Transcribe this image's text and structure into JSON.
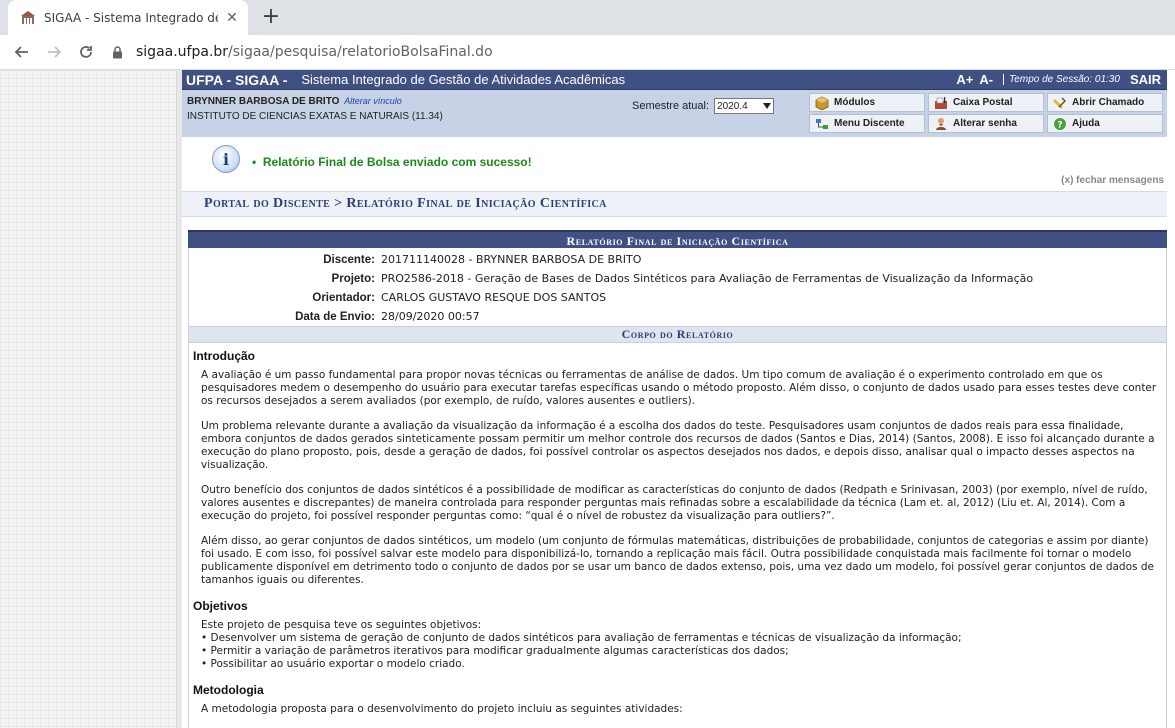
{
  "browser": {
    "tab_title": "SIGAA - Sistema Integrado de Gestão",
    "url_host": "sigaa.ufpa.br",
    "url_path": "/sigaa/pesquisa/relatorioBolsaFinal.do"
  },
  "header": {
    "logo": "UFPA - SIGAA -",
    "subtitle": "Sistema Integrado de Gestão de Atividades Acadêmicas",
    "font_increase": "A+",
    "font_decrease": "A-",
    "session_label": "Tempo de Sessão: 01:30",
    "logout": "SAIR"
  },
  "user": {
    "name": "BRYNNER BARBOSA DE BRITO",
    "change_link": "Alterar vínculo",
    "institute": "INSTITUTO DE CIENCIAS EXATAS E NATURAIS (11.34)",
    "semester_label": "Semestre atual:",
    "semester_value": "2020.4"
  },
  "menu": {
    "modulos": "Módulos",
    "caixa_postal": "Caixa Postal",
    "abrir_chamado": "Abrir Chamado",
    "menu_discente": "Menu Discente",
    "alterar_senha": "Alterar senha",
    "ajuda": "Ajuda"
  },
  "message": {
    "text": "Relatório Final de Bolsa enviado com sucesso!",
    "close": "(x) fechar mensagens"
  },
  "breadcrumb": "Portal do Discente > Relatório Final de Iniciação Científica",
  "report": {
    "title": "Relatório Final de Iniciação Científica",
    "fields": [
      {
        "label": "Discente:",
        "value": "201711140028 - BRYNNER BARBOSA DE BRITO"
      },
      {
        "label": "Projeto:",
        "value": "PRO2586-2018 - Geração de Bases de Dados Sintéticos para Avaliação de Ferramentas de Visualização da Informação"
      },
      {
        "label": "Orientador:",
        "value": "CARLOS GUSTAVO RESQUE DOS SANTOS"
      },
      {
        "label": "Data de Envio:",
        "value": "28/09/2020 00:57"
      }
    ],
    "body_title": "Corpo do Relatório",
    "intro_title": "Introdução",
    "intro_paragraphs": [
      "A avaliação é um passo fundamental para propor novas técnicas ou ferramentas de análise de dados. Um tipo comum de avaliação é o experimento controlado em que os pesquisadores medem o desempenho do usuário para executar tarefas específicas usando o método proposto. Além disso, o conjunto de dados usado para esses testes deve conter os recursos desejados a serem avaliados (por exemplo, de ruído, valores ausentes e outliers).",
      "Um problema relevante durante a avaliação da visualização da informação é a escolha dos dados do teste. Pesquisadores usam conjuntos de dados reais para essa finalidade, embora conjuntos de dados gerados sinteticamente possam permitir um melhor controle dos recursos de dados (Santos e Dias, 2014) (Santos, 2008). E isso foi alcançado durante a execução do plano proposto, pois, desde a geração de dados, foi possível controlar os aspectos desejados nos dados, e depois disso, analisar qual o impacto desses aspectos na visualização.",
      "Outro benefício dos conjuntos de dados sintéticos é a possibilidade de modificar as características do conjunto de dados (Redpath e Srinivasan, 2003) (por exemplo, nível de ruído, valores ausentes e discrepantes) de maneira controlada para responder perguntas mais refinadas sobre a escalabilidade da técnica (Lam et. al, 2012) (Liu et. Al, 2014). Com a execução do projeto, foi possível responder perguntas como: “qual é o nível de robustez da visualização para outliers?”.",
      "Além disso, ao gerar conjuntos de dados sintéticos, um modelo (um conjunto de fórmulas matemáticas, distribuições de probabilidade, conjuntos de categorias e assim por diante) foi usado. E com isso, foi possível salvar este modelo para disponibilizá-lo, tornando a replicação mais fácil. Outra possibilidade conquistada mais facilmente foi tornar o modelo publicamente disponível em detrimento todo o conjunto de dados por se usar um banco de dados extenso, pois, uma vez dado um modelo, foi possível gerar conjuntos de dados de tamanhos iguais ou diferentes."
    ],
    "objetivos_title": "Objetivos",
    "objetivos_intro": "Este projeto de pesquisa teve os seguintes objetivos:",
    "objetivos_items": [
      "• Desenvolver um sistema de geração de conjunto de dados sintéticos para avaliação de ferramentas e técnicas de visualização da informação;",
      "• Permitir a variação de parâmetros iterativos para modificar gradualmente algumas características dos dados;",
      "• Possibilitar ao usuário exportar o modelo criado."
    ],
    "metodologia_title": "Metodologia",
    "metodologia_intro": "A metodologia proposta para o desenvolvimento do projeto incluiu as seguintes atividades:"
  }
}
